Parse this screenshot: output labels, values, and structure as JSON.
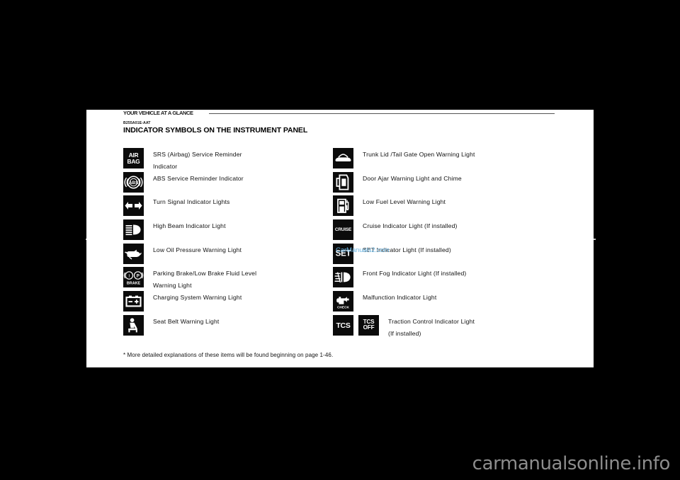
{
  "document": {
    "running_head": "YOUR VEHICLE AT A GLANCE",
    "doc_code": "B255A01E-AAT",
    "title": "INDICATOR SYMBOLS ON THE INSTRUMENT PANEL",
    "footnote": "* More detailed explanations of these items will be found beginning on page 1-46.",
    "watermark": "CarManuals2.com",
    "site_watermark": "carmanualsonline.info",
    "watermark_color": "#6cb8e6",
    "page_background": "#ffffff",
    "field_background": "#000000",
    "icon_background": "#0b0b0b",
    "icon_foreground": "#ffffff"
  },
  "columns": {
    "left": [
      {
        "icon": "airbag-icon",
        "icon_text": "AIR BAG",
        "label_line1": "SRS (Airbag) Service Reminder",
        "label_line2": "Indicator"
      },
      {
        "icon": "abs-icon",
        "icon_text": "ABS",
        "label_line1": "ABS Service Reminder Indicator",
        "label_line2": ""
      },
      {
        "icon": "turn-signal-icon",
        "icon_text": "",
        "label_line1": "Turn Signal Indicator Lights",
        "label_line2": ""
      },
      {
        "icon": "high-beam-icon",
        "icon_text": "",
        "label_line1": "High Beam Indicator Light",
        "label_line2": ""
      },
      {
        "icon": "low-oil-pressure-icon",
        "icon_text": "",
        "label_line1": "Low Oil Pressure Warning Light",
        "label_line2": ""
      },
      {
        "icon": "parking-brake-icon",
        "icon_text": "BRAKE",
        "label_line1": "Parking Brake/Low Brake Fluid Level",
        "label_line2": "Warning Light"
      },
      {
        "icon": "charging-system-icon",
        "icon_text": "",
        "label_line1": "Charging System Warning Light",
        "label_line2": ""
      },
      {
        "icon": "seat-belt-icon",
        "icon_text": "",
        "label_line1": "Seat Belt Warning Light",
        "label_line2": ""
      }
    ],
    "right": [
      {
        "icon": "trunk-lid-open-icon",
        "icon_text": "",
        "label_line1": "Trunk Lid /Tail Gate Open Warning Light",
        "label_line2": ""
      },
      {
        "icon": "door-ajar-icon",
        "icon_text": "",
        "label_line1": "Door Ajar Warning Light and Chime",
        "label_line2": ""
      },
      {
        "icon": "low-fuel-icon",
        "icon_text": "",
        "label_line1": "Low Fuel Level Warning Light",
        "label_line2": ""
      },
      {
        "icon": "cruise-icon",
        "icon_text": "CRUISE",
        "label_line1": "Cruise Indicator Light (If installed)",
        "label_line2": ""
      },
      {
        "icon": "set-icon",
        "icon_text": "SET",
        "label_line1": "SET Indicator Light (If installed)",
        "label_line2": ""
      },
      {
        "icon": "front-fog-icon",
        "icon_text": "",
        "label_line1": "Front Fog Indicator Light (If installed)",
        "label_line2": ""
      },
      {
        "icon": "malfunction-check-engine-icon",
        "icon_text": "CHECK",
        "label_line1": "Malfunction Indicator Light",
        "label_line2": ""
      },
      {
        "icon": "tcs-icon",
        "icon_text": "TCS",
        "icon_text_2": "TCS OFF",
        "label_line1": "Traction Control Indicator Light",
        "label_line2": "(If installed)"
      }
    ]
  }
}
